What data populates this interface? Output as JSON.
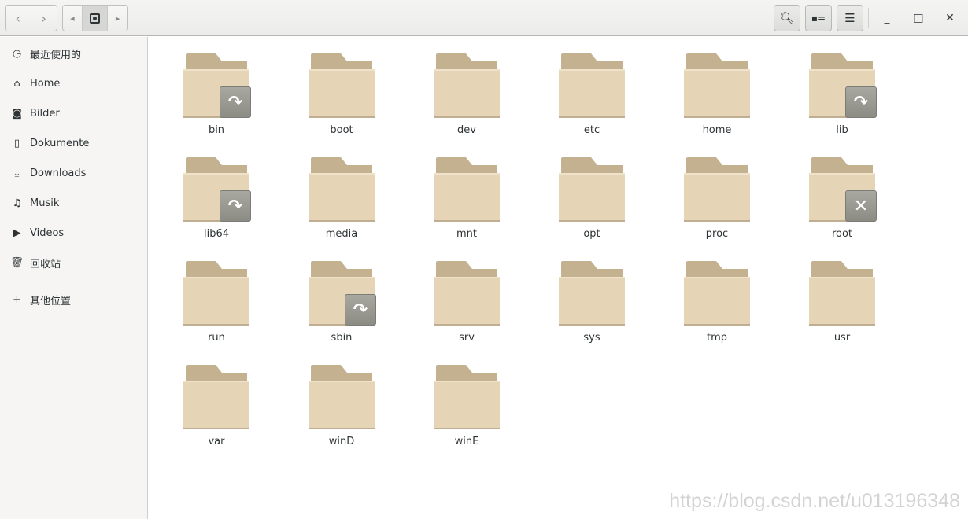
{
  "header": {
    "back": "‹",
    "forward": "›",
    "path_prev": "◂",
    "path_next": "▸",
    "location_icon": "drive-icon",
    "search": "search-icon",
    "view": "list-view-icon",
    "menu": "menu-icon",
    "minimize": "_",
    "maximize": "□",
    "close": "✕"
  },
  "sidebar": {
    "items": [
      {
        "label": "最近使用的",
        "icon": "◷",
        "name": "recent"
      },
      {
        "label": "Home",
        "icon": "⌂",
        "name": "home"
      },
      {
        "label": "Bilder",
        "icon": "◙",
        "name": "pictures"
      },
      {
        "label": "Dokumente",
        "icon": "▯",
        "name": "documents"
      },
      {
        "label": "Downloads",
        "icon": "⤓",
        "name": "downloads"
      },
      {
        "label": "Musik",
        "icon": "♫",
        "name": "music"
      },
      {
        "label": "Videos",
        "icon": "▶",
        "name": "videos"
      },
      {
        "label": "回收站",
        "icon": "🗑",
        "name": "trash"
      }
    ],
    "other": {
      "label": "其他位置",
      "icon": "+"
    }
  },
  "files": [
    {
      "name": "bin",
      "emblem": "symlink"
    },
    {
      "name": "boot"
    },
    {
      "name": "dev"
    },
    {
      "name": "etc"
    },
    {
      "name": "home"
    },
    {
      "name": "lib",
      "emblem": "symlink"
    },
    {
      "name": "lib64",
      "emblem": "symlink"
    },
    {
      "name": "media"
    },
    {
      "name": "mnt"
    },
    {
      "name": "opt"
    },
    {
      "name": "proc"
    },
    {
      "name": "root",
      "emblem": "unreadable"
    },
    {
      "name": "run"
    },
    {
      "name": "sbin",
      "emblem": "symlink"
    },
    {
      "name": "srv"
    },
    {
      "name": "sys"
    },
    {
      "name": "tmp"
    },
    {
      "name": "usr"
    },
    {
      "name": "var"
    },
    {
      "name": "winD"
    },
    {
      "name": "winE"
    }
  ],
  "watermark": "https://blog.csdn.net/u013196348"
}
